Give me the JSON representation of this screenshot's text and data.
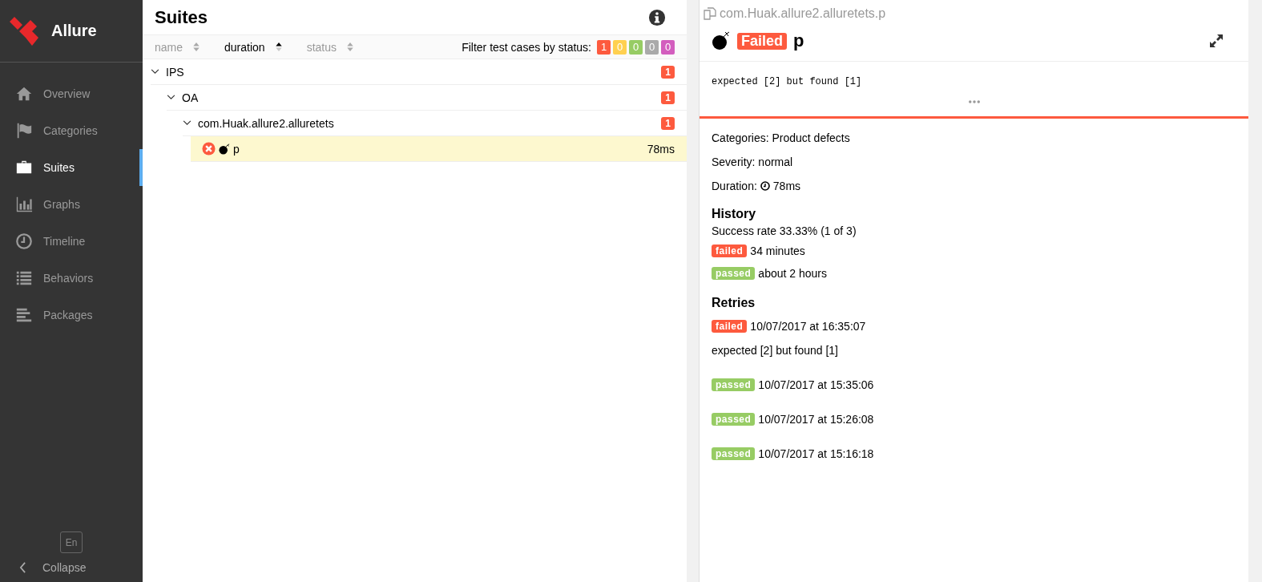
{
  "sidebar": {
    "brand": "Allure",
    "items": [
      {
        "label": "Overview",
        "selected": false
      },
      {
        "label": "Categories",
        "selected": false
      },
      {
        "label": "Suites",
        "selected": true
      },
      {
        "label": "Graphs",
        "selected": false
      },
      {
        "label": "Timeline",
        "selected": false
      },
      {
        "label": "Behaviors",
        "selected": false
      },
      {
        "label": "Packages",
        "selected": false
      }
    ],
    "language": "En",
    "collapse": "Collapse"
  },
  "suites": {
    "title": "Suites",
    "sort_columns": [
      {
        "label": "name",
        "selected": false
      },
      {
        "label": "duration",
        "selected": true
      },
      {
        "label": "status",
        "selected": false
      }
    ],
    "filter_label": "Filter test cases by status:",
    "status_filters": [
      {
        "count": "1",
        "color": "#fd5a3e"
      },
      {
        "count": "0",
        "color": "#ffd050"
      },
      {
        "count": "0",
        "color": "#97cc64"
      },
      {
        "count": "0",
        "color": "#aaaaaa"
      },
      {
        "count": "0",
        "color": "#d35ebe"
      }
    ],
    "tree": [
      {
        "kind": "group",
        "name": "IPS",
        "count": "1",
        "expanded": true,
        "children": [
          {
            "kind": "group",
            "name": "OA",
            "count": "1",
            "expanded": true,
            "children": [
              {
                "kind": "group",
                "name": "com.Huak.allure2.alluretets",
                "count": "1",
                "expanded": true,
                "children": [
                  {
                    "kind": "test",
                    "name": "p",
                    "duration": "78ms",
                    "color": "#fd5a3e",
                    "selected": true
                  }
                ]
              }
            ]
          }
        ]
      }
    ]
  },
  "detail": {
    "path": "com.Huak.allure2.alluretets.p",
    "status": "Failed",
    "name": "p",
    "message": "expected [2] but found [1]",
    "categories": "Categories: Product defects",
    "severity": "Severity: normal",
    "duration_label": "Duration:",
    "duration": "78ms",
    "history_title": "History",
    "success_rate": "Success rate 33.33% (1 of 3)",
    "history": [
      {
        "status": "failed",
        "text": "34 minutes"
      },
      {
        "status": "passed",
        "text": "about 2 hours"
      }
    ],
    "retries_title": "Retries",
    "retries": [
      {
        "status": "failed",
        "text": "10/07/2017 at 16:35:07",
        "message": "expected [2] but found [1]"
      },
      {
        "status": "passed",
        "text": "10/07/2017 at 15:35:06"
      },
      {
        "status": "passed",
        "text": "10/07/2017 at 15:26:08"
      },
      {
        "status": "passed",
        "text": "10/07/2017 at 15:16:18"
      }
    ]
  }
}
